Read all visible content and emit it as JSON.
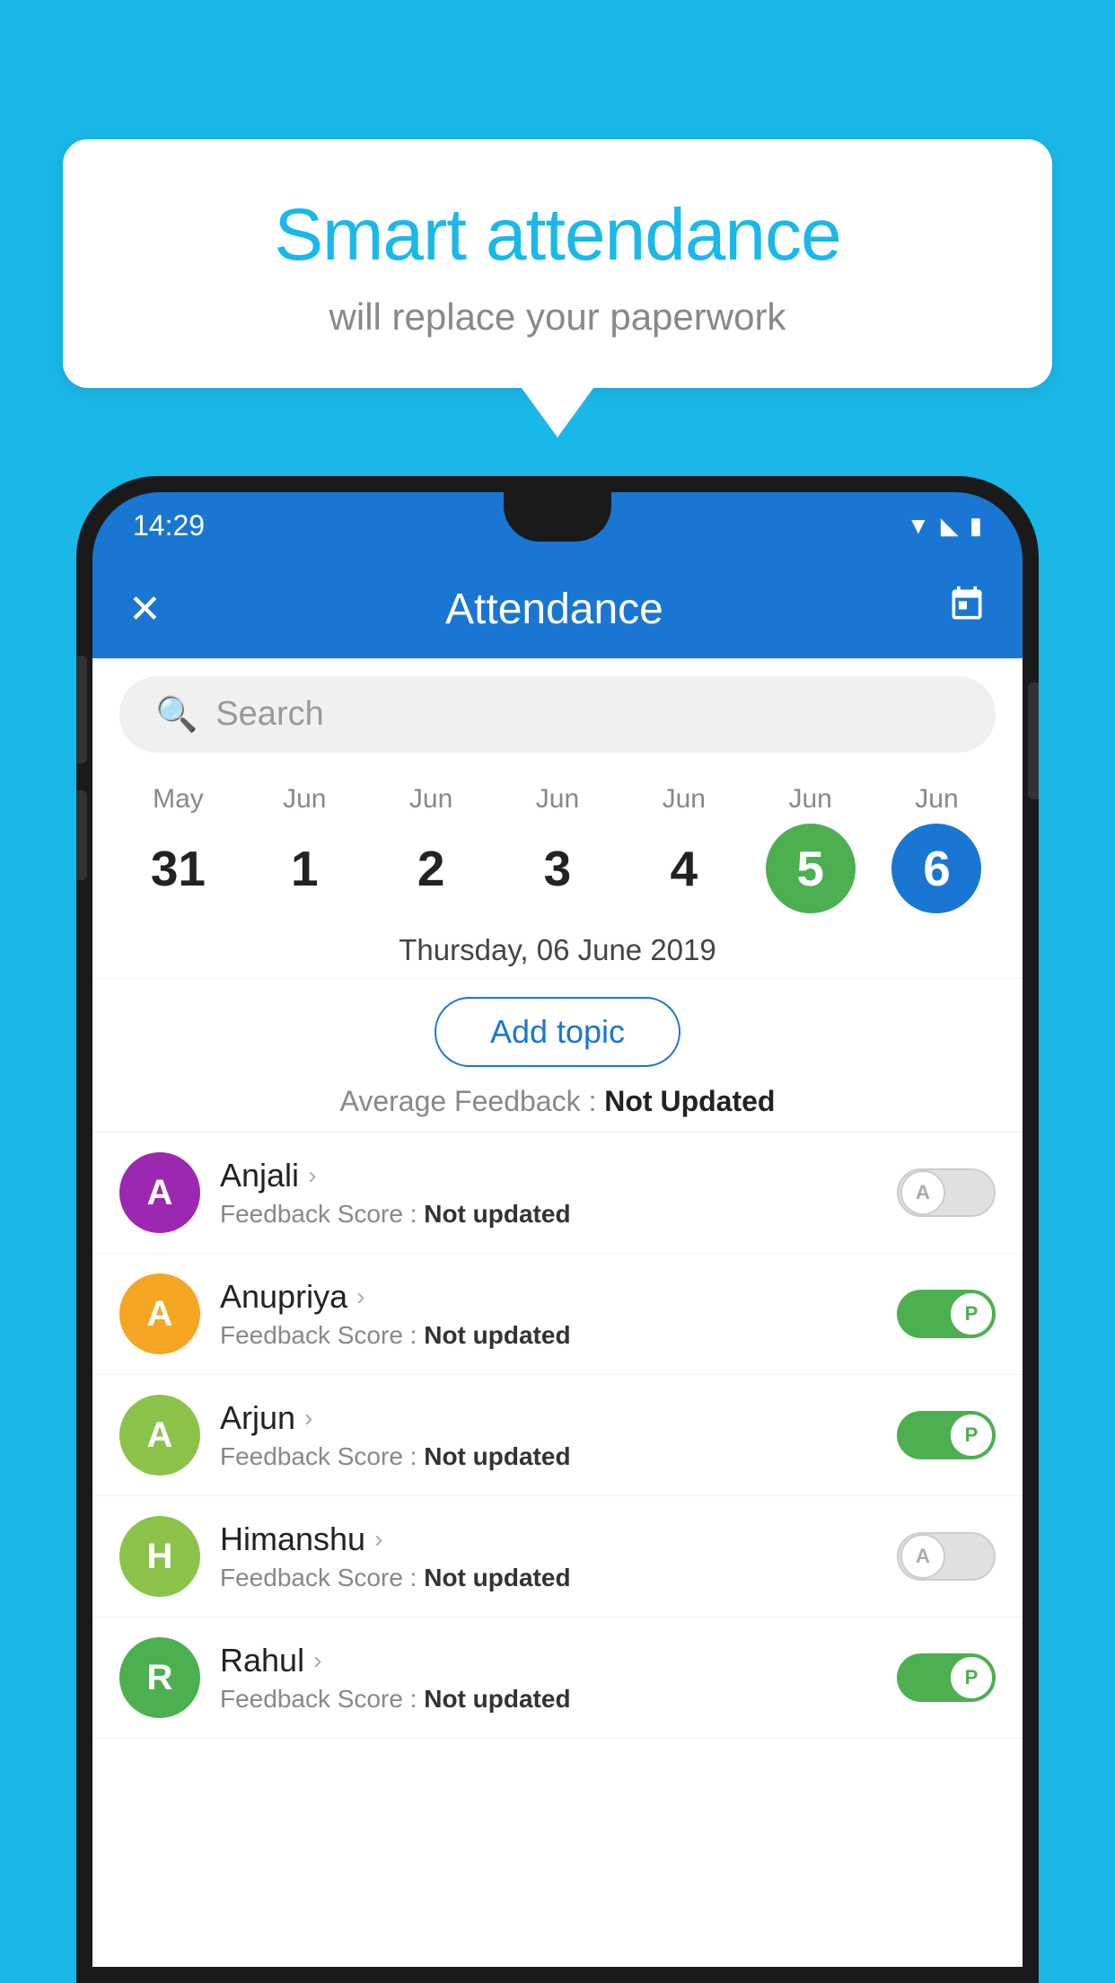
{
  "background": {
    "color": "#1ab8e8"
  },
  "hero": {
    "title": "Smart attendance",
    "subtitle": "will replace your paperwork"
  },
  "status_bar": {
    "time": "14:29",
    "icons": [
      "wifi",
      "signal",
      "battery"
    ]
  },
  "app_bar": {
    "close_label": "✕",
    "title": "Attendance",
    "calendar_icon": "📅"
  },
  "search": {
    "placeholder": "Search"
  },
  "calendar": {
    "days": [
      {
        "month": "May",
        "date": "31",
        "state": "normal"
      },
      {
        "month": "Jun",
        "date": "1",
        "state": "normal"
      },
      {
        "month": "Jun",
        "date": "2",
        "state": "normal"
      },
      {
        "month": "Jun",
        "date": "3",
        "state": "normal"
      },
      {
        "month": "Jun",
        "date": "4",
        "state": "normal"
      },
      {
        "month": "Jun",
        "date": "5",
        "state": "today"
      },
      {
        "month": "Jun",
        "date": "6",
        "state": "selected"
      }
    ]
  },
  "selected_date_label": "Thursday, 06 June 2019",
  "add_topic_label": "Add topic",
  "avg_feedback": {
    "label": "Average Feedback : ",
    "value": "Not Updated"
  },
  "students": [
    {
      "name": "Anjali",
      "avatar_letter": "A",
      "avatar_color": "#9c27b0",
      "feedback": "Not updated",
      "attendance": "absent"
    },
    {
      "name": "Anupriya",
      "avatar_letter": "A",
      "avatar_color": "#f5a623",
      "feedback": "Not updated",
      "attendance": "present"
    },
    {
      "name": "Arjun",
      "avatar_letter": "A",
      "avatar_color": "#8bc34a",
      "feedback": "Not updated",
      "attendance": "present"
    },
    {
      "name": "Himanshu",
      "avatar_letter": "H",
      "avatar_color": "#8bc34a",
      "feedback": "Not updated",
      "attendance": "absent"
    },
    {
      "name": "Rahul",
      "avatar_letter": "R",
      "avatar_color": "#4caf50",
      "feedback": "Not updated",
      "attendance": "present"
    }
  ]
}
